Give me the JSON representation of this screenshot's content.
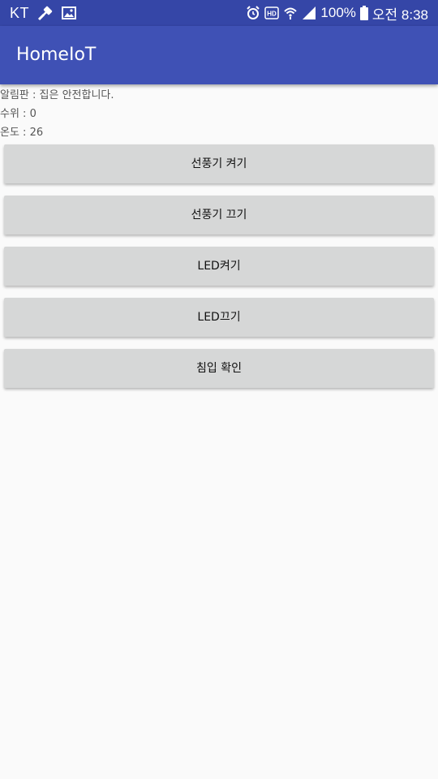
{
  "status_bar": {
    "carrier": "KT",
    "battery": "100%",
    "time": "오전 8:38",
    "icons": [
      "wrench-icon",
      "image-icon",
      "alarm-icon",
      "hd-icon",
      "wifi-icon",
      "signal-icon",
      "battery-icon"
    ]
  },
  "app_bar": {
    "title": "HomeIoT",
    "color": "#3f51b5"
  },
  "info": {
    "notice": "알림판 : 집은 안전합니다.",
    "water_level": "수위 : 0",
    "temperature": "온도 : 26"
  },
  "buttons": {
    "fan_on": "선풍기 켜기",
    "fan_off": "선풍기 끄기",
    "led_on": "LED켜기",
    "led_off": "LED끄기",
    "intrusion_check": "침입 확인"
  }
}
